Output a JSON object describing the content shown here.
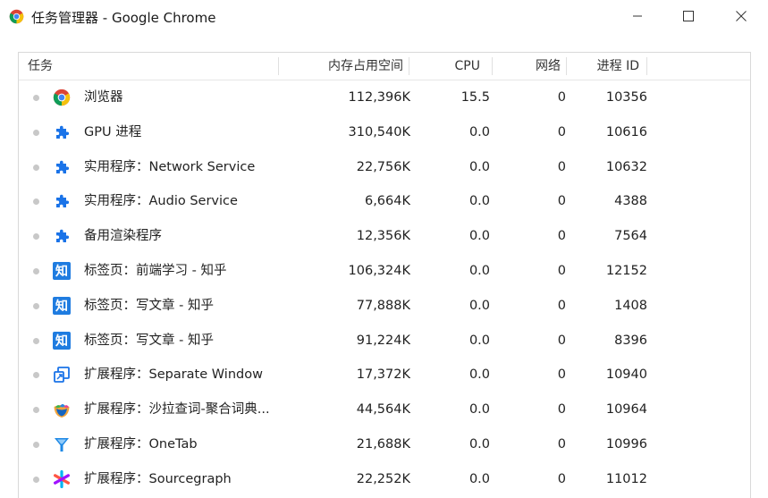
{
  "window": {
    "title": "任务管理器 - Google Chrome"
  },
  "table": {
    "headers": {
      "task": "任务",
      "memory": "内存占用空间",
      "cpu": "CPU",
      "network": "网络",
      "pid": "进程 ID"
    },
    "rows": [
      {
        "name": "浏览器",
        "icon": "chrome-icon",
        "memory": "112,396K",
        "cpu": "15.5",
        "network": "0",
        "pid": "10356"
      },
      {
        "name": "GPU 进程",
        "icon": "puzzle-icon",
        "memory": "310,540K",
        "cpu": "0.0",
        "network": "0",
        "pid": "10616"
      },
      {
        "name": "实用程序：Network Service",
        "icon": "puzzle-icon",
        "memory": "22,756K",
        "cpu": "0.0",
        "network": "0",
        "pid": "10632"
      },
      {
        "name": "实用程序：Audio Service",
        "icon": "puzzle-icon",
        "memory": "6,664K",
        "cpu": "0.0",
        "network": "0",
        "pid": "4388"
      },
      {
        "name": "备用渲染程序",
        "icon": "puzzle-icon",
        "memory": "12,356K",
        "cpu": "0.0",
        "network": "0",
        "pid": "7564"
      },
      {
        "name": "标签页：前端学习 - 知乎",
        "icon": "zhihu-icon",
        "memory": "106,324K",
        "cpu": "0.0",
        "network": "0",
        "pid": "12152"
      },
      {
        "name": "标签页：写文章 - 知乎",
        "icon": "zhihu-icon",
        "memory": "77,888K",
        "cpu": "0.0",
        "network": "0",
        "pid": "1408"
      },
      {
        "name": "标签页：写文章 - 知乎",
        "icon": "zhihu-icon",
        "memory": "91,224K",
        "cpu": "0.0",
        "network": "0",
        "pid": "8396"
      },
      {
        "name": "扩展程序：Separate Window",
        "icon": "separate-window-icon",
        "memory": "17,372K",
        "cpu": "0.0",
        "network": "0",
        "pid": "10940"
      },
      {
        "name": "扩展程序：沙拉查词-聚合词典...",
        "icon": "saladict-icon",
        "memory": "44,564K",
        "cpu": "0.0",
        "network": "0",
        "pid": "10964"
      },
      {
        "name": "扩展程序：OneTab",
        "icon": "onetab-icon",
        "memory": "21,688K",
        "cpu": "0.0",
        "network": "0",
        "pid": "10996"
      },
      {
        "name": "扩展程序：Sourcegraph",
        "icon": "sourcegraph-icon",
        "memory": "22,252K",
        "cpu": "0.0",
        "network": "0",
        "pid": "11012"
      }
    ]
  },
  "icons": {
    "zhihu_glyph": "知"
  },
  "colors": {
    "chrome_red": "#db4437",
    "chrome_yellow": "#f4c20d",
    "chrome_green": "#0f9d58",
    "chrome_blue": "#4285f4",
    "puzzle_blue": "#1a73e8",
    "zhihu_blue": "#1f7ce0"
  }
}
